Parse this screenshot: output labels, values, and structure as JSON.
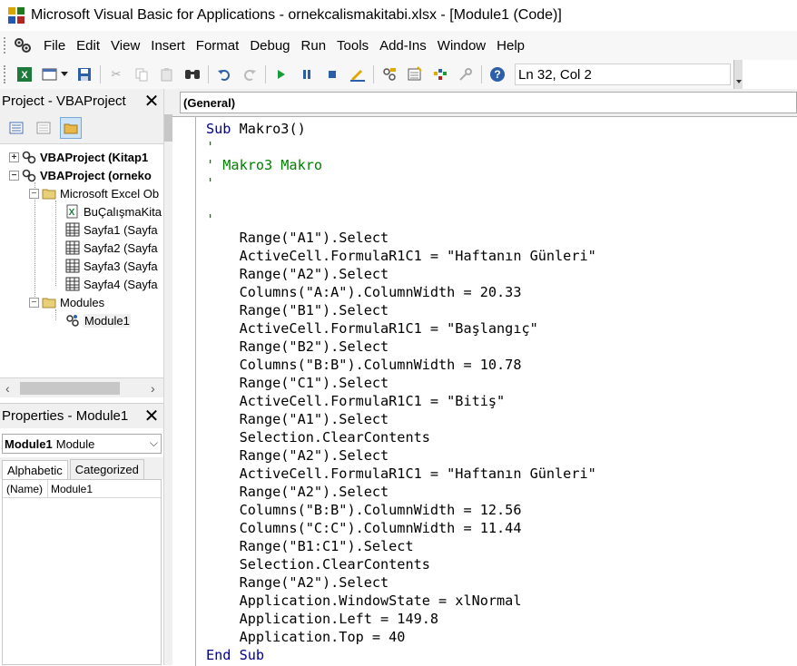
{
  "window": {
    "title": "Microsoft Visual Basic for Applications - ornekcalismakitabi.xlsx - [Module1 (Code)]"
  },
  "menu": {
    "items": [
      "File",
      "Edit",
      "View",
      "Insert",
      "Format",
      "Debug",
      "Run",
      "Tools",
      "Add-Ins",
      "Window",
      "Help"
    ]
  },
  "toolbar": {
    "status": "Ln 32, Col 2",
    "icons": [
      "excel-icon",
      "insert-userform-icon",
      "save-icon",
      "cut-icon",
      "copy-icon",
      "paste-icon",
      "find-icon",
      "undo-icon",
      "redo-icon",
      "run-icon",
      "break-icon",
      "reset-icon",
      "design-mode-icon",
      "project-explorer-icon",
      "properties-window-icon",
      "object-browser-icon",
      "toolbox-icon",
      "help-icon"
    ]
  },
  "project": {
    "title": "Project - VBAProject",
    "tree": {
      "node1": "VBAProject (Kitap1",
      "node2": "VBAProject (orneko",
      "folder_objects": "Microsoft Excel Ob",
      "workbook": "BuÇalışmaKita",
      "sheet1": "Sayfa1 (Sayfa",
      "sheet2": "Sayfa2 (Sayfa",
      "sheet3": "Sayfa3 (Sayfa",
      "sheet4": "Sayfa4 (Sayfa",
      "folder_modules": "Modules",
      "module1": "Module1"
    }
  },
  "properties": {
    "title": "Properties - Module1",
    "object_name": "Module1",
    "object_type": "Module",
    "tabs": [
      "Alphabetic",
      "Categorized"
    ],
    "rows": [
      {
        "key": "(Name)",
        "value": "Module1"
      }
    ]
  },
  "code": {
    "object_combo": "(General)",
    "lines": [
      "Sub Makro3()",
      "'",
      "' Makro3 Makro",
      "'",
      "",
      "'",
      "    Range(\"A1\").Select",
      "    ActiveCell.FormulaR1C1 = \"Haftanın Günleri\"",
      "    Range(\"A2\").Select",
      "    Columns(\"A:A\").ColumnWidth = 20.33",
      "    Range(\"B1\").Select",
      "    ActiveCell.FormulaR1C1 = \"Başlangıç\"",
      "    Range(\"B2\").Select",
      "    Columns(\"B:B\").ColumnWidth = 10.78",
      "    Range(\"C1\").Select",
      "    ActiveCell.FormulaR1C1 = \"Bitiş\"",
      "    Range(\"A1\").Select",
      "    Selection.ClearContents",
      "    Range(\"A2\").Select",
      "    ActiveCell.FormulaR1C1 = \"Haftanın Günleri\"",
      "    Range(\"A2\").Select",
      "    Columns(\"B:B\").ColumnWidth = 12.56",
      "    Columns(\"C:C\").ColumnWidth = 11.44",
      "    Range(\"B1:C1\").Select",
      "    Selection.ClearContents",
      "    Range(\"A2\").Select",
      "    Application.WindowState = xlNormal",
      "    Application.Left = 149.8",
      "    Application.Top = 40",
      "End Sub"
    ]
  },
  "colors": {
    "comment": "#008000",
    "keyword": "#00008b",
    "chrome": "#f0f0f0"
  }
}
